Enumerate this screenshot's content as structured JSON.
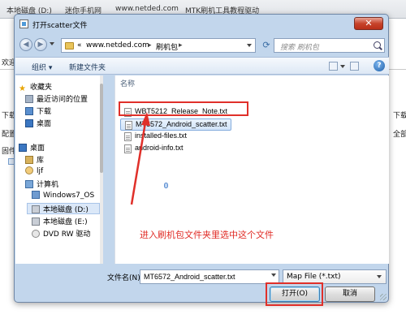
{
  "background_window": {
    "breadcrumb": [
      "本地磁盘 (D:)",
      "迷你手机网",
      "www.netded.com",
      "MTK刷机工具教程驱动"
    ],
    "side_labels": [
      "欢迎",
      "下载",
      "配置",
      "固件"
    ],
    "right_labels": [
      "下载",
      "全部"
    ]
  },
  "dialog": {
    "title": "打开scatter文件",
    "close_glyph": "✕",
    "address": {
      "prefix": "«",
      "crumbs": [
        "www.netded.com",
        "刷机包"
      ],
      "refresh_glyph": "⟳"
    },
    "search": {
      "placeholder": "搜索 刷机包"
    },
    "toolbar": {
      "organize": "组织 ▾",
      "new_folder": "新建文件夹",
      "help_glyph": "?"
    },
    "nav": {
      "items": [
        {
          "label": "收藏夹",
          "icon": "star-icon"
        },
        {
          "label": "最近访问的位置",
          "icon": "recent-places-icon"
        },
        {
          "label": "下载",
          "icon": "downloads-folder-icon"
        },
        {
          "label": "桌面",
          "icon": "desktop-icon"
        },
        {
          "label": "桌面",
          "icon": "desktop-icon"
        },
        {
          "label": "库",
          "icon": "library-icon"
        },
        {
          "label": "ljf",
          "icon": "user-folder-icon"
        },
        {
          "label": "计算机",
          "icon": "computer-icon"
        },
        {
          "label": "Windows7_OS",
          "icon": "windows-drive-icon"
        },
        {
          "label": "本地磁盘 (D:)",
          "icon": "drive-icon"
        },
        {
          "label": "本地磁盘 (E:)",
          "icon": "drive-icon"
        },
        {
          "label": "DVD RW 驱动",
          "icon": "dvd-drive-icon"
        }
      ]
    },
    "files": {
      "column_header": "名称",
      "items": [
        {
          "name": "WBT5212_Release_Note.txt",
          "selected": false
        },
        {
          "name": "MT6572_Android_scatter.txt",
          "selected": true
        },
        {
          "name": "installed-files.txt",
          "selected": false
        },
        {
          "name": "android-info.txt",
          "selected": false
        }
      ]
    },
    "annotation": {
      "text": "进入刷机包文件夹里选中这个文件",
      "color": "#e0302a"
    },
    "filename": {
      "label": "文件名(N):",
      "value": "MT6572_Android_scatter.txt"
    },
    "filter": {
      "value": "Map File (*.txt)"
    },
    "buttons": {
      "open": "打开(O)",
      "cancel": "取消"
    }
  }
}
